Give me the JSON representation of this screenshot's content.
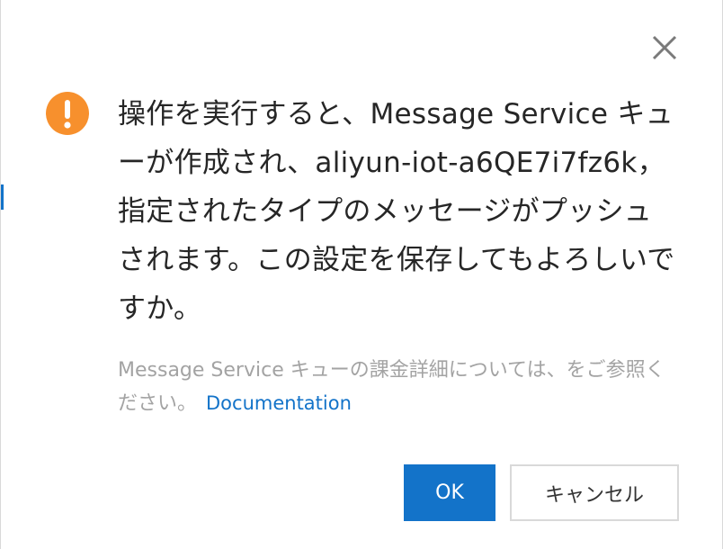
{
  "dialog": {
    "message": "操作を実行すると、Message Service キューが作成され、aliyun-iot-a6QE7i7fz6k，指定されたタイプのメッセージがプッシュされます。この設定を保存してもよろしいですか。",
    "note": "Message Service キューの課金詳細については、をご参照ください。",
    "doc_link": "Documentation",
    "ok_label": "OK",
    "cancel_label": "キャンセル",
    "warning_icon": "exclamation-circle-icon",
    "close_icon": "close-icon"
  },
  "colors": {
    "warning": "#f7902d",
    "primary": "#1373c9",
    "text": "#262626",
    "muted": "#a3a3a3"
  }
}
